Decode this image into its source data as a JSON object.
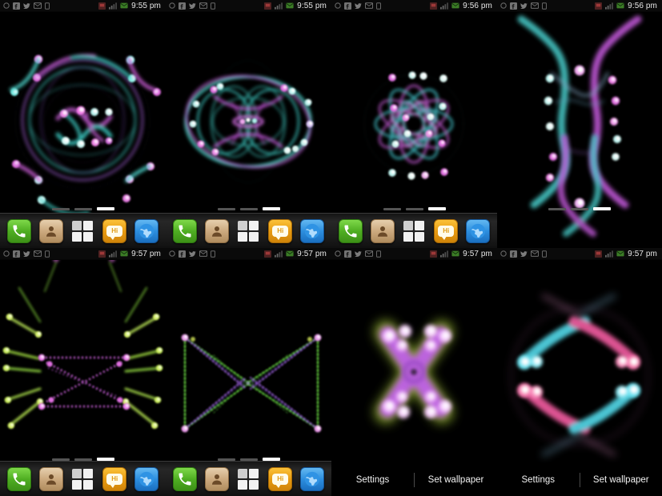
{
  "statusbar": {
    "left_icons": [
      "sync-icon",
      "facebook-icon",
      "twitter-icon",
      "mail-icon",
      "sim-card-icon"
    ],
    "right_icons": [
      "notification-flag-icon",
      "signal-bars-icon",
      "envelope-icon"
    ]
  },
  "dock": {
    "items": [
      {
        "name": "phone",
        "label": "Phone"
      },
      {
        "name": "contacts",
        "label": "Contacts"
      },
      {
        "name": "app-drawer",
        "label": "Apps"
      },
      {
        "name": "messaging",
        "label": "Hi"
      },
      {
        "name": "browser",
        "label": "Browser"
      }
    ],
    "messaging_glyph": "Hi"
  },
  "pager": {
    "count": 3,
    "active_index": 2
  },
  "wallpaper_bar": {
    "settings_label": "Settings",
    "set_wallpaper_label": "Set wallpaper"
  },
  "colors": {
    "cyan": "#5fe8e0",
    "magenta": "#d060e0",
    "pink": "#ff4f93",
    "green": "#8ed23f",
    "yellow": "#d4e24a",
    "violet": "#b06cf0",
    "white": "#ffffff",
    "background": "#000000",
    "dock_base": "#272727",
    "status_text": "#e8e8e8"
  },
  "panels": [
    {
      "id": "panel-1",
      "time": "9:55 pm",
      "wallpaper_name": "orbit-spirograph",
      "has_dock": true,
      "has_wallpaper_bar": false,
      "description": "Concentric circular orbits with cyan and magenta glowing comet dots"
    },
    {
      "id": "panel-2",
      "time": "9:55 pm",
      "wallpaper_name": "rose-ring-spirograph",
      "has_dock": true,
      "has_wallpaper_bar": false,
      "description": "Interlocking petal rings in cyan and magenta forming a rose"
    },
    {
      "id": "panel-3",
      "time": "9:56 pm",
      "wallpaper_name": "six-petal-rosette",
      "has_dock": true,
      "has_wallpaper_bar": false,
      "description": "Six petal rosette with radiating cyan and magenta dots"
    },
    {
      "id": "panel-4",
      "time": "9:56 pm",
      "wallpaper_name": "vertical-braid",
      "has_dock": false,
      "has_wallpaper_bar": false,
      "description": "Two vertical braided strands of cyan and magenta beads crossing at top and bottom"
    },
    {
      "id": "panel-5",
      "time": "9:57 pm",
      "wallpaper_name": "green-rays-magenta-x",
      "has_dock": true,
      "has_wallpaper_bar": false,
      "description": "Yellow-green rays fanning outward around a magenta dotted X"
    },
    {
      "id": "panel-6",
      "time": "9:57 pm",
      "wallpaper_name": "bowtie-lattice",
      "has_dock": true,
      "has_wallpaper_bar": false,
      "description": "Green and violet dotted bowtie lattice between four corner nodes"
    },
    {
      "id": "panel-7",
      "time": "9:57 pm",
      "wallpaper_name": "glowing-x-orb",
      "has_dock": false,
      "has_wallpaper_bar": true,
      "description": "Blurred glowing purple X with bright white-pink orbs and green halo"
    },
    {
      "id": "panel-8",
      "time": "9:57 pm",
      "wallpaper_name": "four-comets",
      "has_dock": false,
      "has_wallpaper_bar": true,
      "description": "Four cyan and pink comet trails curving around a circle"
    }
  ]
}
